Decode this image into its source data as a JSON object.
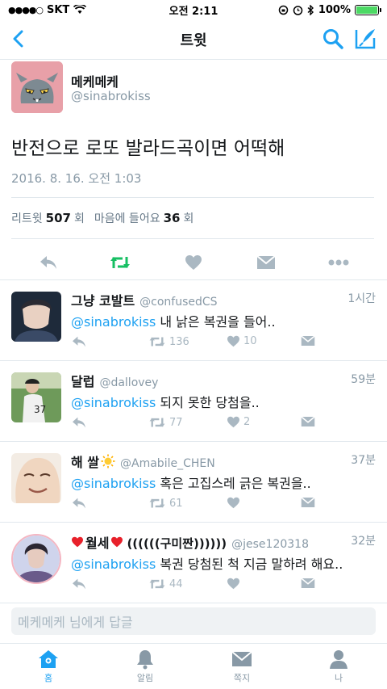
{
  "status_bar": {
    "carrier": "SKT",
    "time": "오전 2:11",
    "battery": "100%"
  },
  "nav": {
    "title": "트윗"
  },
  "tweet": {
    "author_name": "메케메케",
    "author_handle": "@sinabrokiss",
    "text": "반전으로 로또 발라드곡이면 어떡해",
    "timestamp": "2016. 8. 16. 오전 1:03",
    "retweets_label": "리트윗",
    "retweets_count": "507",
    "retweets_suffix": "회",
    "likes_label": "마음에 들어요",
    "likes_count": "36",
    "likes_suffix": "회"
  },
  "replies": [
    {
      "name": "그냥 코발트",
      "handle": "@confusedCS",
      "time": "1시간",
      "mention": "@sinabrokiss",
      "text": " 내 낡은 복권을 들어..",
      "retweets": "136",
      "likes": "10"
    },
    {
      "name": "달럽",
      "handle": "@dallovey",
      "time": "59분",
      "mention": "@sinabrokiss",
      "text": " 되지 못한 당첨을..",
      "retweets": "77",
      "likes": "2"
    },
    {
      "name": "해 쌀",
      "handle": "@Amabile_CHEN",
      "time": "37분",
      "mention": "@sinabrokiss",
      "text": " 혹은 고집스레 긁은 복권을..",
      "retweets": "61",
      "likes": ""
    },
    {
      "name": "월세",
      "name_suffix": "((((((구미짠))))))",
      "handle": "@jese120318",
      "time": "32분",
      "mention": "@sinabrokiss",
      "text": " 복권 당첨된 척 지금 말하려 해요..",
      "retweets": "44",
      "likes": ""
    }
  ],
  "reply_box": {
    "placeholder": "메케메케 님에게 답글"
  },
  "tabs": [
    {
      "label": "홈",
      "icon": "home-icon"
    },
    {
      "label": "알림",
      "icon": "bell-icon"
    },
    {
      "label": "쪽지",
      "icon": "envelope-icon"
    },
    {
      "label": "나",
      "icon": "person-icon"
    }
  ],
  "colors": {
    "accent": "#1da1f2",
    "retweet_green": "#17bf63",
    "muted": "#8899a6"
  }
}
